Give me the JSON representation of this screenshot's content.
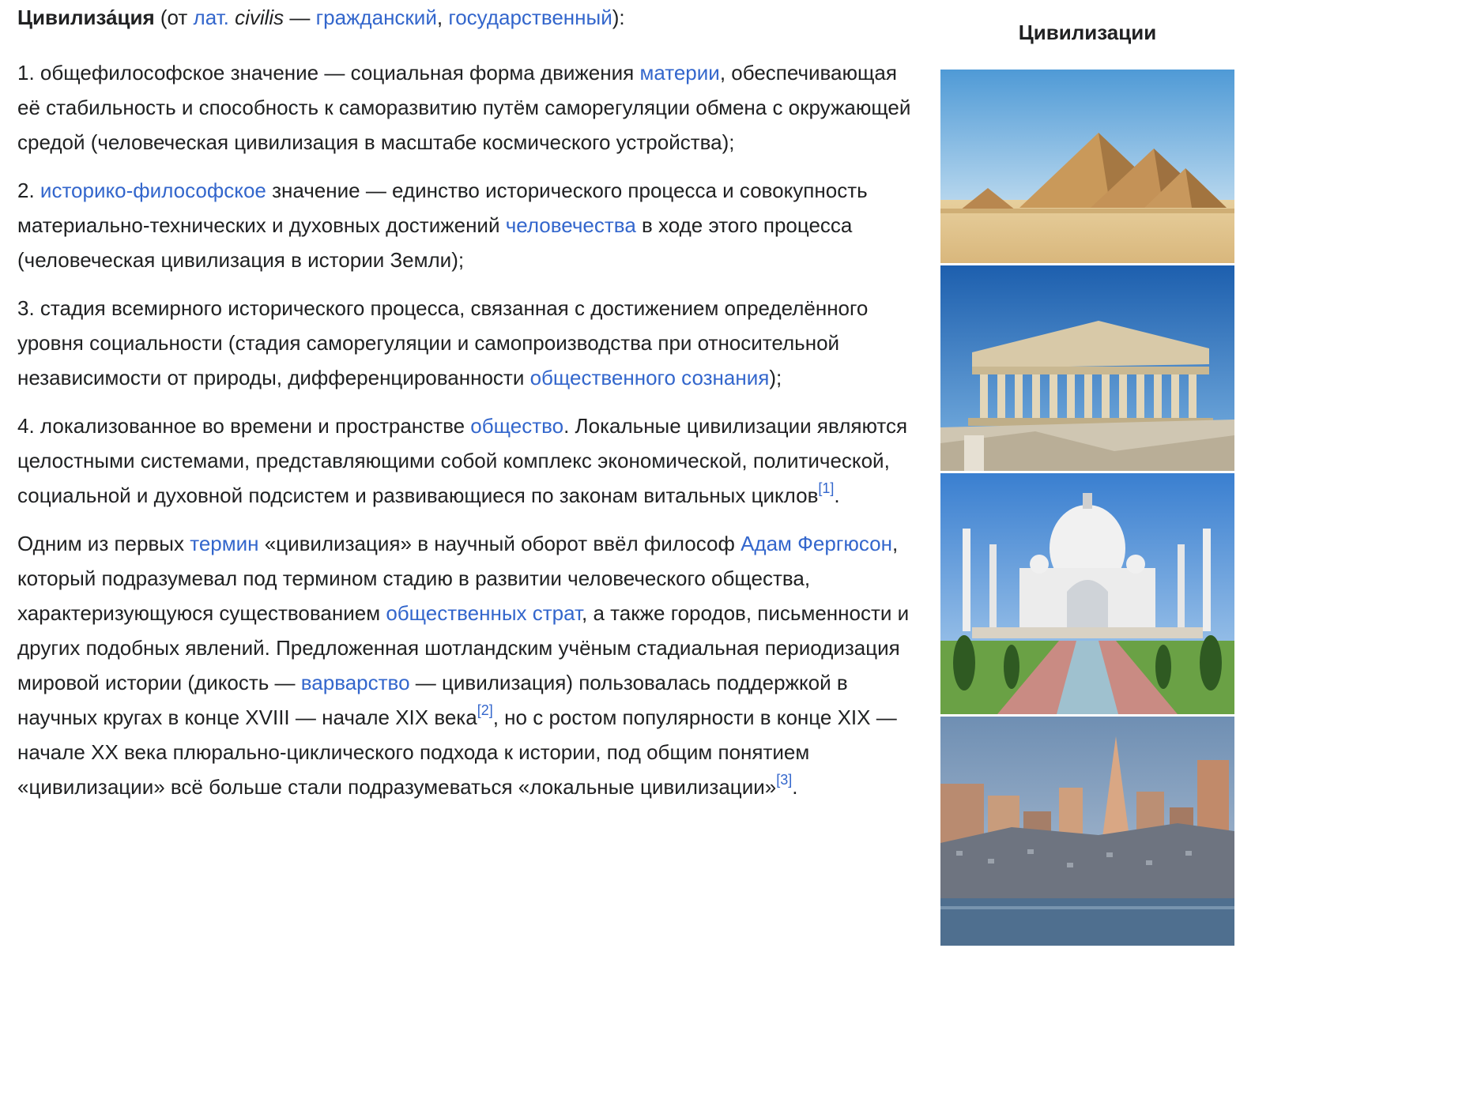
{
  "article": {
    "lead": {
      "term": "Цивилиза́ция",
      "open": " (от ",
      "lat_link": "лат.",
      "latin_word_pre": " ",
      "latin_word": "civilis",
      "dash": " — ",
      "link1": "гражданский",
      "comma": ", ",
      "link2": "государственный",
      "close": "):"
    },
    "p1": {
      "t1": "1. общефилософское значение — социальная форма движения ",
      "link_matter": "материи",
      "t2": ", обеспечивающая её стабильность и способность к саморазвитию путём саморегуляции обмена с окружающей средой (человеческая цивилизация в масштабе космического устройства);"
    },
    "p2": {
      "t1": "2. ",
      "link_hist": "историко-философское",
      "t2": " значение — единство исторического процесса и совокупность материально-технических и духовных достижений ",
      "link_humanity": "человечества",
      "t3": " в ходе этого процесса (человеческая цивилизация в истории Земли);"
    },
    "p3": {
      "t1": "3. стадия всемирного исторического процесса, связанная с достижением определённого уровня социальности (стадия саморегуляции и самопроизводства при относительной независимости от природы, дифференцированности ",
      "link_consciousness": "общественного сознания",
      "t2": ");"
    },
    "p4": {
      "t1": "4. локализованное во времени и пространстве ",
      "link_society": "общество",
      "t2": ". Локальные цивилизации являются целостными системами, представляющими собой комплекс экономической, политической, социальной и духовной подсистем и развивающиеся по законам витальных циклов",
      "ref1": "[1]",
      "t3": "."
    },
    "p5": {
      "t1": "Одним из первых ",
      "link_term": "термин",
      "t2": " «цивилизация» в научный оборот ввёл философ ",
      "link_ferguson": "Адам Фергюсон",
      "t3": ", который подразумевал под термином стадию в развитии человеческого общества, характеризующуюся существованием ",
      "link_strata": "общественных страт",
      "t4": ", а также городов, письменности и других подобных явлений. Предложенная шотландским учёным стадиальная периодизация мировой истории (дикость — ",
      "link_barbarism": "варварство",
      "t5": " — цивилизация) пользовалась поддержкой в научных кругах в конце XVIII — начале XIX века",
      "ref2": "[2]",
      "t6": ", но с ростом популярности в конце XIX — начале XX века плюрально-циклического подхода к истории, под общим понятием «цивилизации» всё больше стали подразумеваться «локальные цивилизации»",
      "ref3": "[3]",
      "t7": "."
    }
  },
  "infobox": {
    "title": "Цивилизации"
  },
  "colors": {
    "link": "#3366cc",
    "text": "#202122",
    "background": "#ffffff"
  }
}
